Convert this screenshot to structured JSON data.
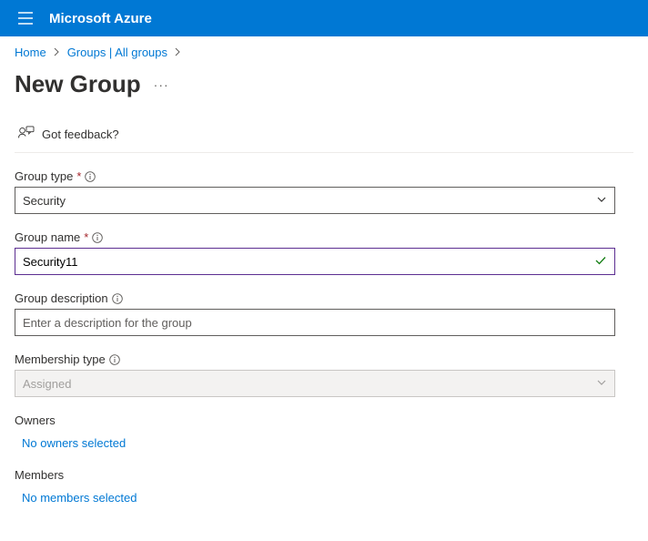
{
  "header": {
    "brand": "Microsoft Azure"
  },
  "breadcrumb": {
    "home": "Home",
    "groups": "Groups | All groups"
  },
  "page": {
    "title": "New Group",
    "feedback": "Got feedback?"
  },
  "form": {
    "group_type": {
      "label": "Group type",
      "value": "Security"
    },
    "group_name": {
      "label": "Group name",
      "value": "Security11"
    },
    "group_description": {
      "label": "Group description",
      "placeholder": "Enter a description for the group"
    },
    "membership_type": {
      "label": "Membership type",
      "value": "Assigned"
    },
    "owners": {
      "heading": "Owners",
      "link": "No owners selected"
    },
    "members": {
      "heading": "Members",
      "link": "No members selected"
    }
  }
}
